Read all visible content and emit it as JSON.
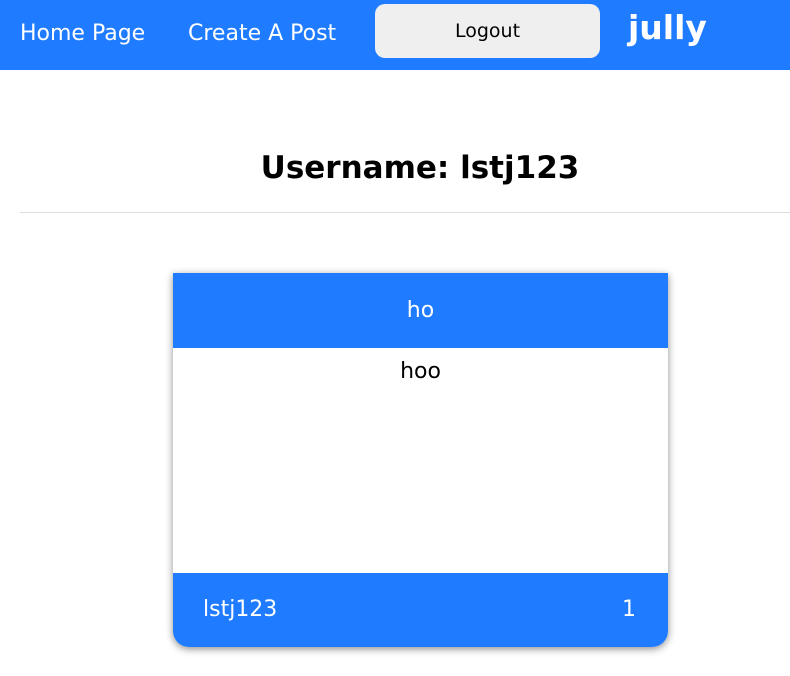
{
  "navbar": {
    "home_label": "Home Page",
    "create_label": "Create A Post",
    "logout_label": "Logout",
    "brand": "jully",
    "background_color": "#1f7bff"
  },
  "profile": {
    "title": "Username: lstj123"
  },
  "posts": [
    {
      "title": "ho",
      "body": "hoo",
      "username": "lstj123",
      "likes": "1"
    }
  ]
}
